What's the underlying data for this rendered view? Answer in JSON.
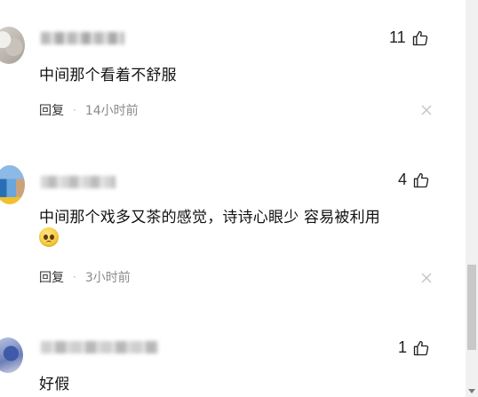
{
  "comments": [
    {
      "likes": "11",
      "text": "中间那个看着不舒服",
      "reply_label": "回复",
      "dot": "·",
      "time": "14小时前"
    },
    {
      "likes": "4",
      "text": "中间那个戏多又茶的感觉，诗诗心眼少 容易被利用",
      "reply_label": "回复",
      "dot": "·",
      "time": "3小时前"
    },
    {
      "likes": "1",
      "text": "好假"
    }
  ],
  "icons": {
    "like": "thumbs-up-icon",
    "close": "close-icon"
  },
  "colors": {
    "text": "#111111",
    "meta": "#8a8a8a",
    "scroll_thumb": "#c8c8c8"
  }
}
